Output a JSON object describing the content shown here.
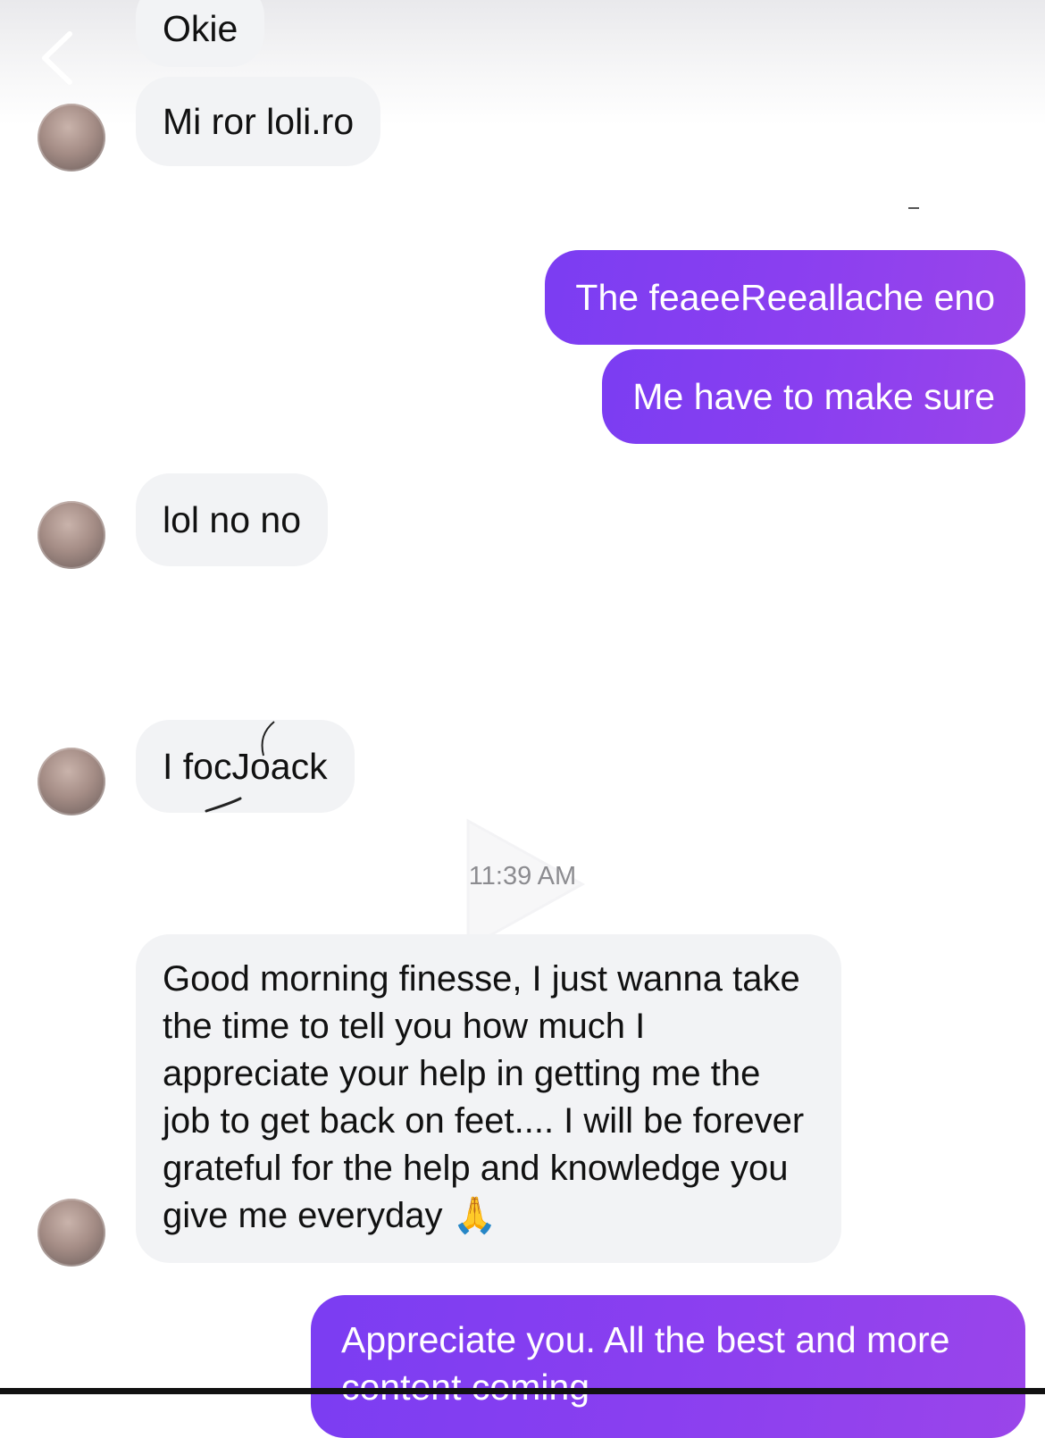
{
  "header": {
    "back_icon": "chevron-left-icon"
  },
  "messages": [
    {
      "id": "m1",
      "direction": "incoming",
      "text": "Okie"
    },
    {
      "id": "m2",
      "direction": "incoming",
      "text": "Mi ror loli.ro"
    },
    {
      "id": "m3",
      "direction": "outgoing",
      "text": "The feaeeReeallache eno"
    },
    {
      "id": "m4",
      "direction": "outgoing",
      "text": "Me have to make sure"
    },
    {
      "id": "m5",
      "direction": "incoming",
      "text": "lol no no"
    },
    {
      "id": "m6",
      "direction": "incoming",
      "text": "I focJoack"
    },
    {
      "id": "m7",
      "direction": "incoming",
      "text": "Good morning finesse, I just wanna take the time to tell you how much I appreciate your help in getting me the job to get back on feet.... I will be forever grateful for the help and knowledge you give me everyday 🙏"
    },
    {
      "id": "m8",
      "direction": "outgoing",
      "text": "Appreciate you. All the best and more content coming"
    }
  ],
  "timestamp": "11:39 AM",
  "colors": {
    "outgoing_bubble": "#8a3ff0",
    "incoming_bubble": "#f2f3f5",
    "timestamp_text": "#8c8c90"
  }
}
